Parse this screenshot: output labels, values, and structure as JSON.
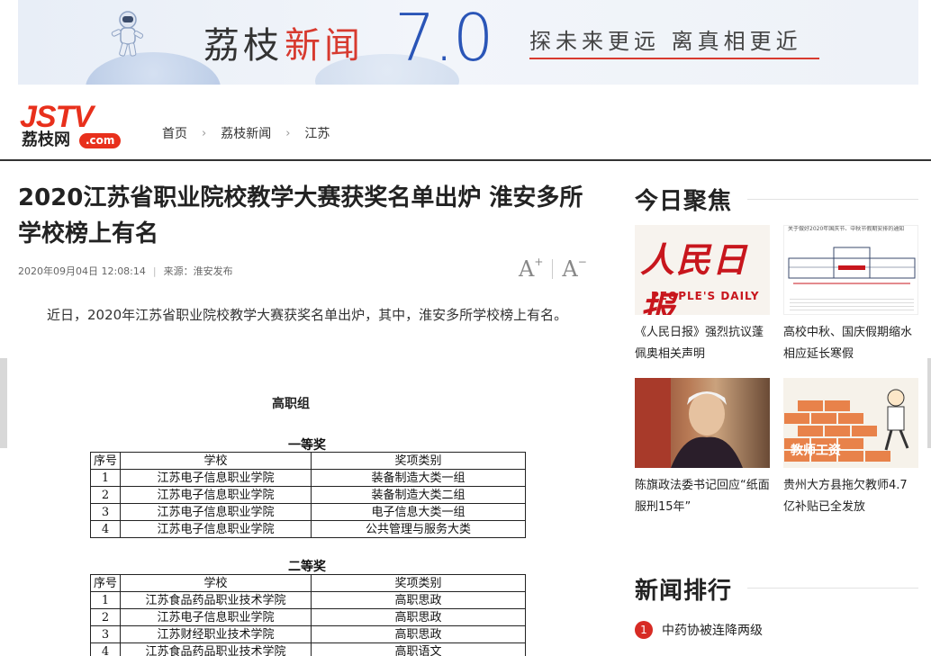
{
  "banner": {
    "name_part1": "荔枝",
    "name_part2": "新闻",
    "version": "7.0",
    "slogan": "探未来更远  离真相更近"
  },
  "logo": {
    "brand": "JSTV",
    "site_name": "荔枝网",
    "domain": ".com"
  },
  "breadcrumb": {
    "items": [
      "首页",
      "荔枝新闻",
      "江苏"
    ],
    "separator": "›"
  },
  "article": {
    "title": "2020江苏省职业院校教学大赛获奖名单出炉 淮安多所学校榜上有名",
    "datetime": "2020年09月04日  12:08:14",
    "source": "来源：淮安发布",
    "font_increase": "A",
    "font_increase_mark": "+",
    "font_decrease": "A",
    "font_decrease_mark": "−",
    "lead": "近日，2020年江苏省职业院校教学大赛获奖名单出炉，其中，淮安多所学校榜上有名。",
    "group_title": "高职组",
    "columns": [
      "序号",
      "学校",
      "奖项类别"
    ],
    "first_prize": {
      "title": "一等奖",
      "rows": [
        [
          "1",
          "江苏电子信息职业学院",
          "装备制造大类一组"
        ],
        [
          "2",
          "江苏电子信息职业学院",
          "装备制造大类二组"
        ],
        [
          "3",
          "江苏电子信息职业学院",
          "电子信息大类一组"
        ],
        [
          "4",
          "江苏电子信息职业学院",
          "公共管理与服务大类"
        ]
      ]
    },
    "second_prize": {
      "title": "二等奖",
      "rows": [
        [
          "1",
          "江苏食品药品职业技术学院",
          "高职思政"
        ],
        [
          "2",
          "江苏电子信息职业学院",
          "高职思政"
        ],
        [
          "3",
          "江苏财经职业技术学院",
          "高职思政"
        ],
        [
          "4",
          "江苏食品药品职业技术学院",
          "高职语文"
        ]
      ]
    }
  },
  "focus": {
    "heading": "今日聚焦",
    "cards": [
      {
        "caption": "《人民日报》强烈抗议蓬佩奥相关声明",
        "thumb_title": "人民日报",
        "thumb_sub": "PEOPLE'S DAILY"
      },
      {
        "caption": "高校中秋、国庆假期缩水 相应延长寒假",
        "thumb_title": "关于做好2020年国庆节、中秋节假期安排的通知"
      },
      {
        "caption": "陈旗政法委书记回应“纸面服刑15年”"
      },
      {
        "caption": "贵州大方县拖欠教师4.7亿补贴已全发放",
        "thumb_title": "教师工资"
      }
    ]
  },
  "ranking": {
    "heading": "新闻排行",
    "items": [
      {
        "rank": "1",
        "title": "中药协被连降两级"
      }
    ]
  },
  "colors": {
    "accent_red": "#d72b24",
    "brand_red": "#e8301c",
    "banner_blue": "#2a55b7"
  }
}
